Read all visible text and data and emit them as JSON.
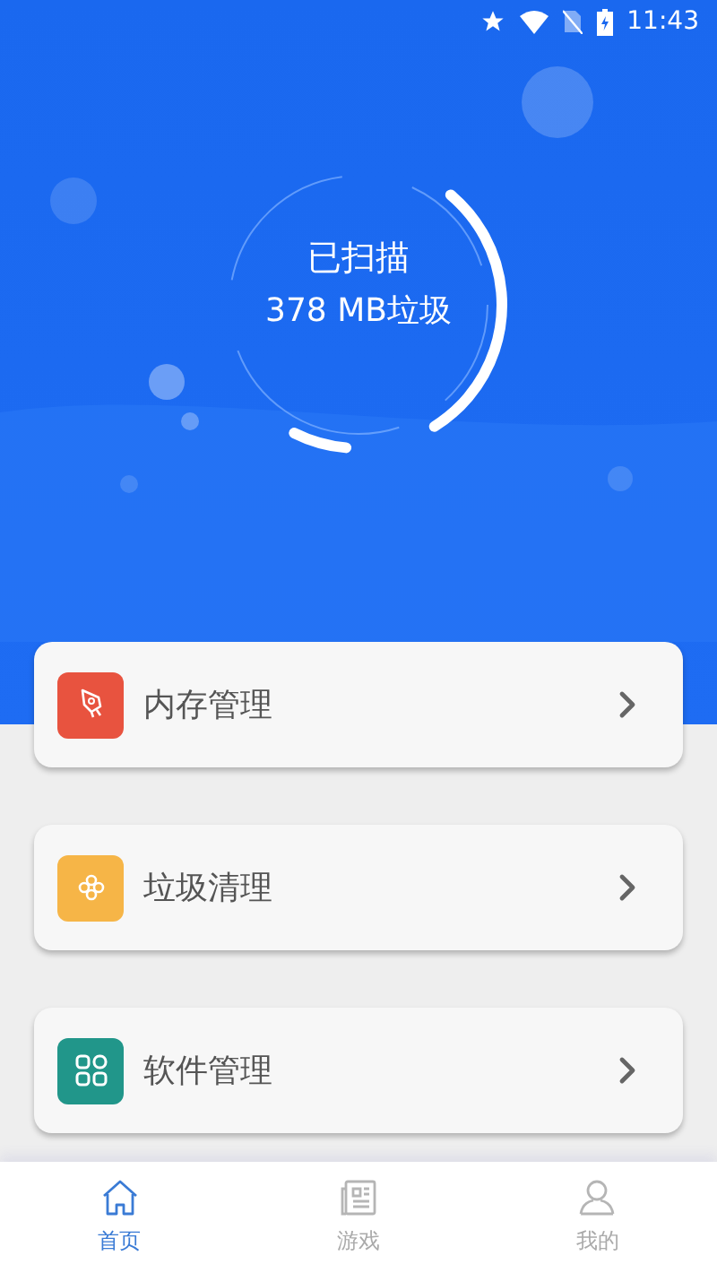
{
  "status_bar": {
    "time": "11:43"
  },
  "scan": {
    "title": "已扫描",
    "result": "378 MB垃圾"
  },
  "menu_items": [
    {
      "kind": "memory",
      "label": "内存管理",
      "color": "#e8533f"
    },
    {
      "kind": "junk",
      "label": "垃圾清理",
      "color": "#f6b547"
    },
    {
      "kind": "apps",
      "label": "软件管理",
      "color": "#21968a"
    }
  ],
  "tabs": [
    {
      "kind": "home",
      "label": "首页",
      "selected": true
    },
    {
      "kind": "games",
      "label": "游戏",
      "selected": false
    },
    {
      "kind": "profile",
      "label": "我的",
      "selected": false
    }
  ]
}
